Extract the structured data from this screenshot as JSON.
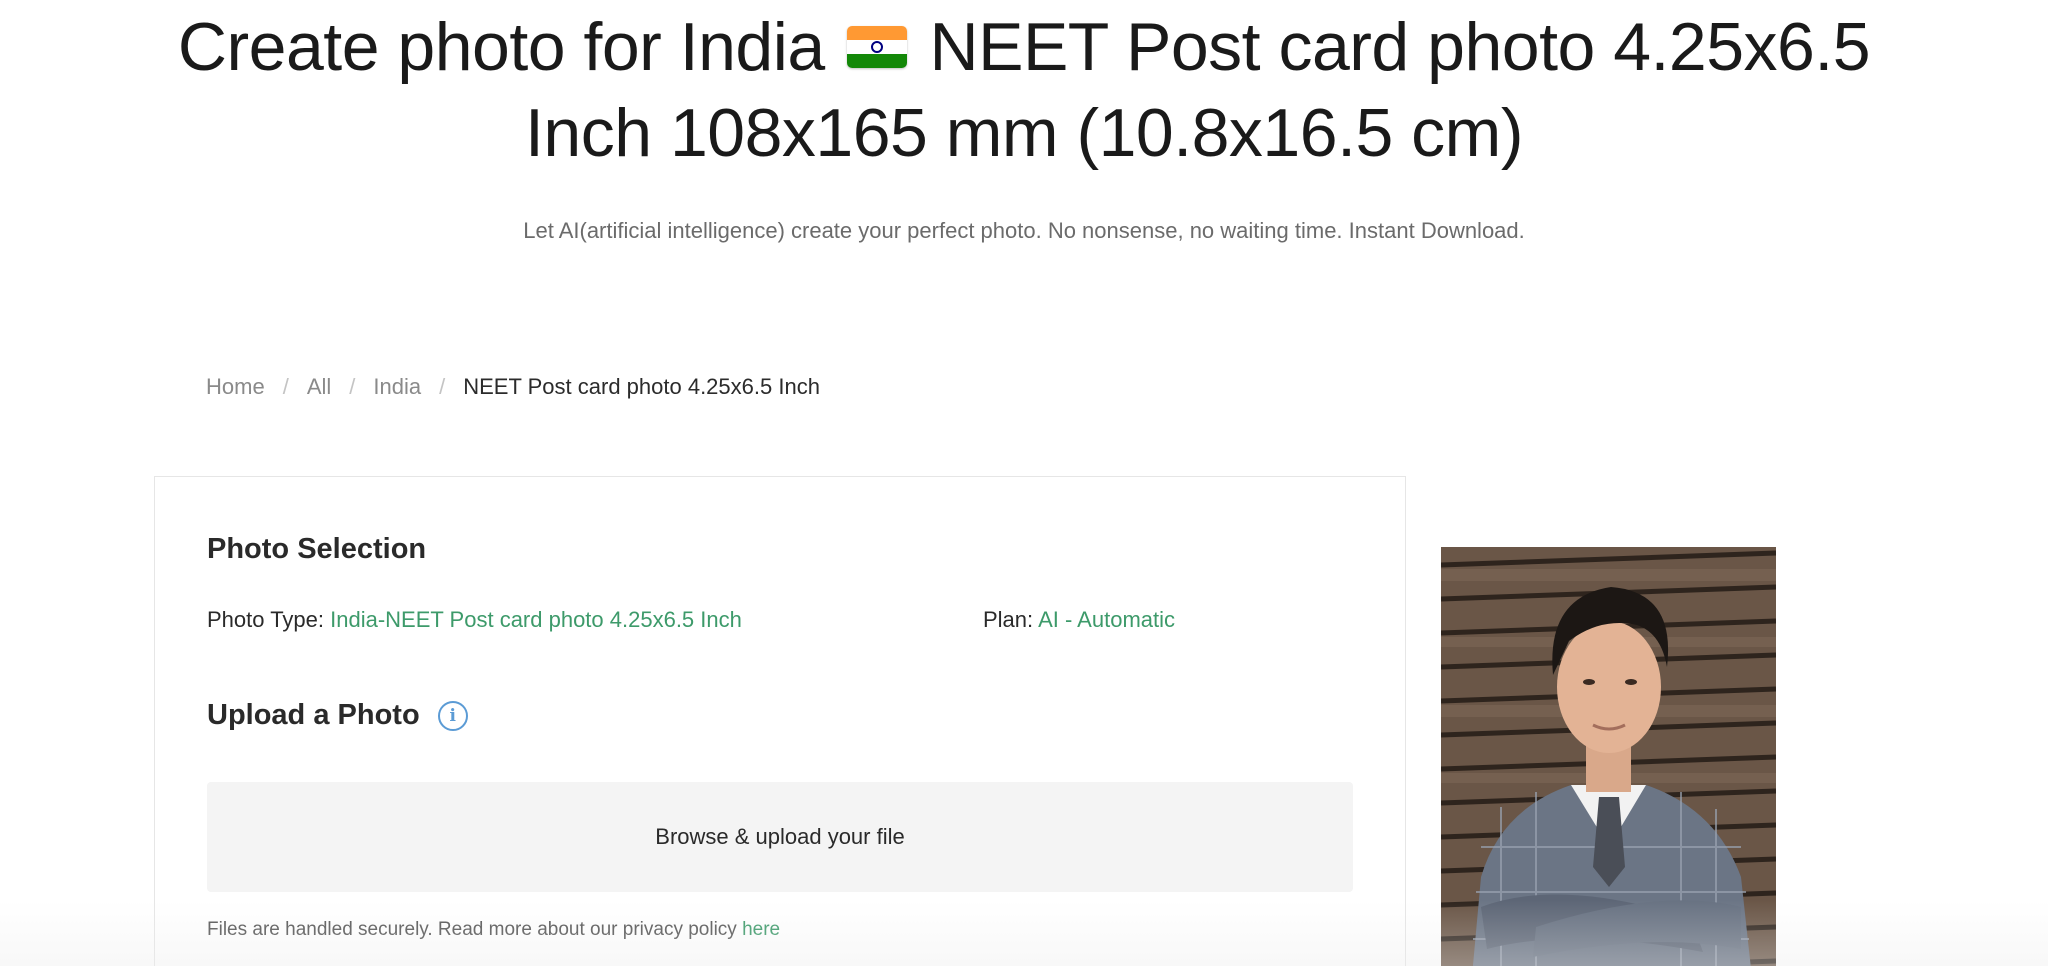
{
  "hero": {
    "title_part1": "Create photo for India",
    "flag_icon": "india-flag-icon",
    "title_part2": "NEET Post card photo 4.25x6.5",
    "title_line2": "Inch 108x165 mm (10.8x16.5 cm)",
    "subtitle": "Let AI(artificial intelligence) create your perfect photo. No nonsense, no waiting time. Instant Download."
  },
  "breadcrumb": {
    "items": [
      "Home",
      "All",
      "India"
    ],
    "separator": "/",
    "current": "NEET Post card photo 4.25x6.5 Inch"
  },
  "selection": {
    "title": "Photo Selection",
    "photo_type_label": "Photo Type:",
    "photo_type_value": "India-NEET Post card photo 4.25x6.5 Inch",
    "plan_label": "Plan:",
    "plan_value": "AI - Automatic"
  },
  "upload": {
    "title": "Upload a Photo",
    "info_icon": "i",
    "button_label": "Browse & upload your file",
    "privacy_text": "Files are handled securely. Read more about our privacy policy",
    "privacy_link": "here"
  },
  "colors": {
    "accent_green": "#3d9a6a",
    "info_blue": "#5b9bd5",
    "upload_bg": "#f4f4f4"
  }
}
